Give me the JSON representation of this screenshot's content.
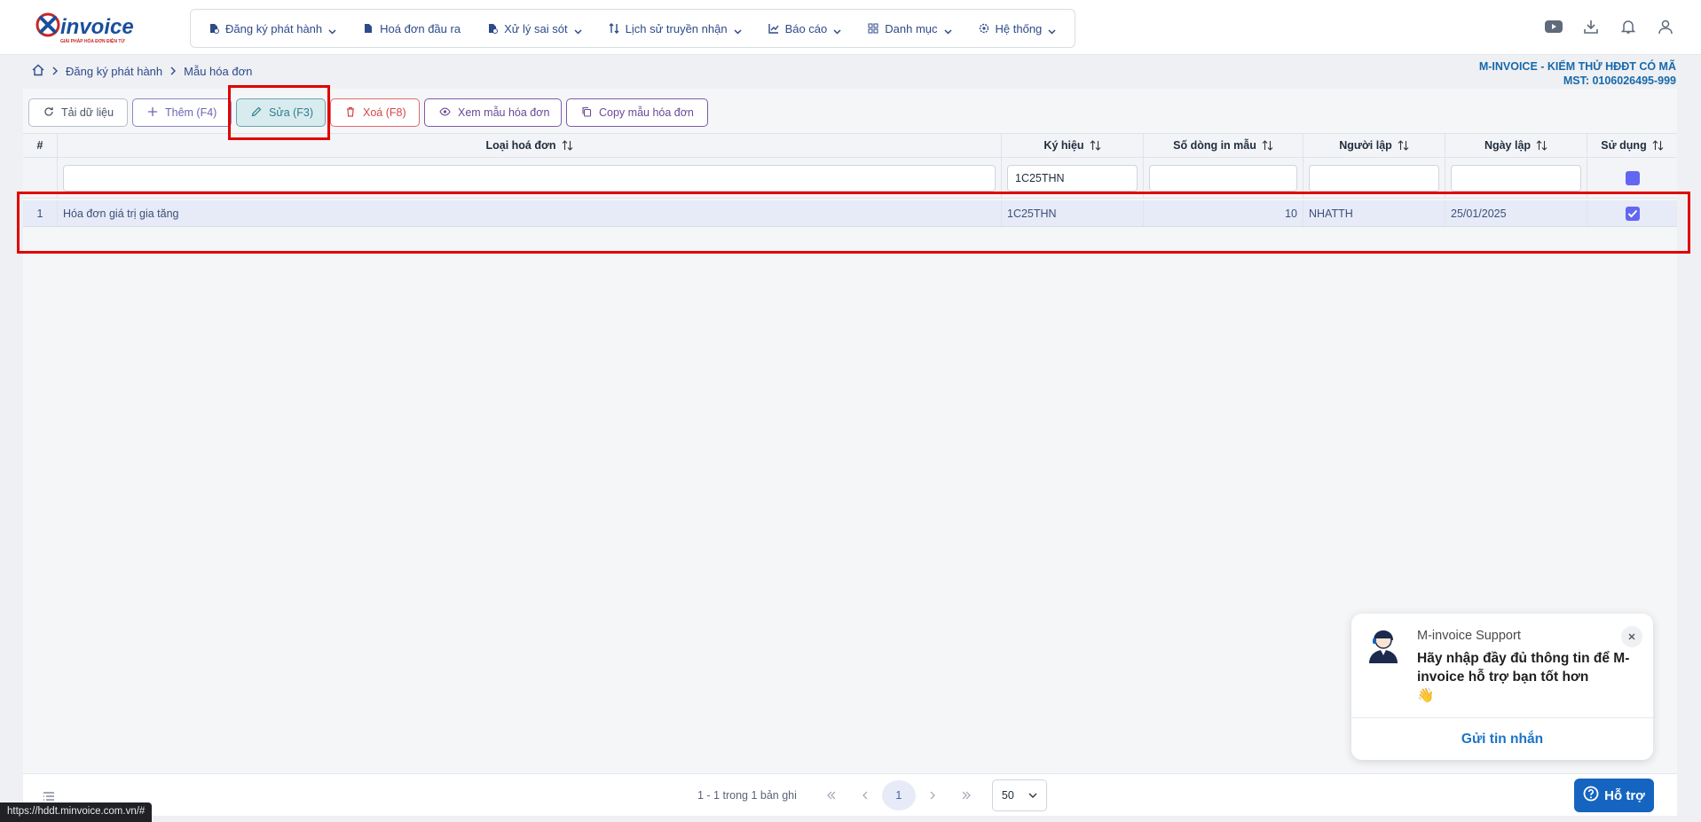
{
  "header": {
    "logo_text": "invoice",
    "logo_tagline": "GIẢI PHÁP HÓA ĐƠN ĐIỆN TỬ",
    "nav": [
      {
        "label": "Đăng ký phát hành",
        "icon": "file-register-icon",
        "dropdown": true
      },
      {
        "label": "Hoá đơn đầu ra",
        "icon": "file-icon",
        "dropdown": false
      },
      {
        "label": "Xử lý sai sót",
        "icon": "file-fix-icon",
        "dropdown": true
      },
      {
        "label": "Lịch sử truyền nhận",
        "icon": "transfer-icon",
        "dropdown": true
      },
      {
        "label": "Báo cáo",
        "icon": "chart-icon",
        "dropdown": true
      },
      {
        "label": "Danh mục",
        "icon": "grid-icon",
        "dropdown": true
      },
      {
        "label": "Hệ thống",
        "icon": "gear-icon",
        "dropdown": true
      }
    ]
  },
  "breadcrumb": [
    "Đăng ký phát hành",
    "Mẫu hóa đơn"
  ],
  "company": {
    "name": "M-INVOICE - KIỂM THỬ HĐĐT CÓ MÃ",
    "tax": "MST: 0106026495-999"
  },
  "toolbar": {
    "reload": "Tải dữ liệu",
    "add": "Thêm (F4)",
    "edit": "Sửa (F3)",
    "delete": "Xoá (F8)",
    "view": "Xem mẫu hóa đơn",
    "copy": "Copy mẫu hóa đơn"
  },
  "table": {
    "columns": [
      "#",
      "Loại hoá đơn",
      "Ký hiệu",
      "Số dòng in mẫu",
      "Người lập",
      "Ngày lập",
      "Sử dụng"
    ],
    "filters": {
      "loai": "",
      "ky_hieu": "1C25THN",
      "so_dong": "",
      "nguoi_lap": "",
      "ngay_lap": ""
    },
    "rows": [
      {
        "stt": "1",
        "loai": "Hóa đơn giá trị gia tăng",
        "ky_hieu": "1C25THN",
        "so_dong": "10",
        "nguoi_lap": "NHATTH",
        "ngay_lap": "25/01/2025",
        "su_dung": true
      }
    ]
  },
  "pager": {
    "info": "1 - 1 trong 1 bản ghi",
    "current": "1",
    "page_size": "50"
  },
  "status_url": "https://hddt.minvoice.com.vn/#",
  "chat": {
    "who": "M-invoice Support",
    "message": "Hãy nhập đầy đủ thông tin để M-invoice hỗ trợ bạn tốt hơn",
    "emoji": "👋",
    "send": "Gửi tin nhắn",
    "support_button": "Hỗ trợ"
  },
  "colors": {
    "accent": "#6366f1",
    "nav_text": "#2d4a8a",
    "highlight": "#e00000",
    "support": "#1565c0"
  }
}
